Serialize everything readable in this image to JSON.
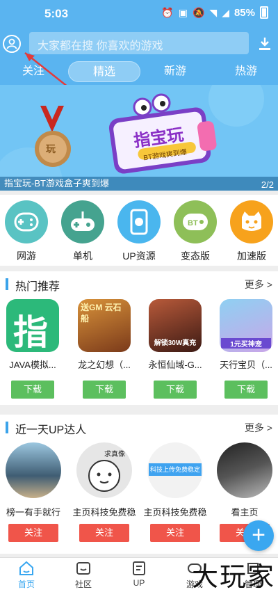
{
  "status": {
    "time": "5:03",
    "battery": "85%"
  },
  "search": {
    "placeholder": "大家都在搜 你喜欢的游戏"
  },
  "tabs": [
    {
      "label": "关注"
    },
    {
      "label": "精选",
      "active": true
    },
    {
      "label": "新游"
    },
    {
      "label": "热游"
    }
  ],
  "banner": {
    "caption": "指宝玩-BT游戏盒子爽到爆",
    "counter": "2/2",
    "title": "指宝玩",
    "sub": "BT游戏爽到爆",
    "medal_text": "玩"
  },
  "categories": [
    {
      "label": "网游",
      "color": "#59c3c3",
      "icon": "gamepad-icon"
    },
    {
      "label": "单机",
      "color": "#45a38f",
      "icon": "joystick-icon"
    },
    {
      "label": "UP资源",
      "color": "#4ab6ee",
      "icon": "share-phone-icon"
    },
    {
      "label": "变态版",
      "color": "#8ebf58",
      "icon": "bt-gamepad-icon"
    },
    {
      "label": "加速版",
      "color": "#f7a21c",
      "icon": "cat-face-icon"
    }
  ],
  "hot": {
    "title": "热门推荐",
    "more": "更多 >",
    "apps": [
      {
        "name": "JAVA模拟...",
        "button": "下载",
        "icon_text": "指"
      },
      {
        "name": "龙之幻想（...",
        "button": "下载",
        "icon_text": "送GM 云石船"
      },
      {
        "name": "永恒仙域-G...",
        "button": "下载",
        "icon_text": "解锁30W真充"
      },
      {
        "name": "天行宝贝（...",
        "button": "下载",
        "icon_text": "1元买神宠"
      }
    ]
  },
  "up": {
    "title": "近一天UP达人",
    "more": "更多 >",
    "users": [
      {
        "name": "榜一有手就行",
        "button": "关注"
      },
      {
        "name": "主页科技免费稳",
        "button": "关注",
        "bubble": "求真像"
      },
      {
        "name": "主页科技免费稳",
        "button": "关注",
        "card_text": "科技上传免费稳定"
      },
      {
        "name": "看主页",
        "button": "关注"
      }
    ]
  },
  "nav": [
    {
      "label": "首页",
      "active": true
    },
    {
      "label": "社区"
    },
    {
      "label": "UP"
    },
    {
      "label": "游戏"
    },
    {
      "label": "管理"
    }
  ],
  "watermark": "大玩家",
  "colors": {
    "primary": "#5ab4f0",
    "accent_blue": "#3aa7f0",
    "download_green": "#5cbf5e",
    "follow_red": "#f0554a"
  }
}
